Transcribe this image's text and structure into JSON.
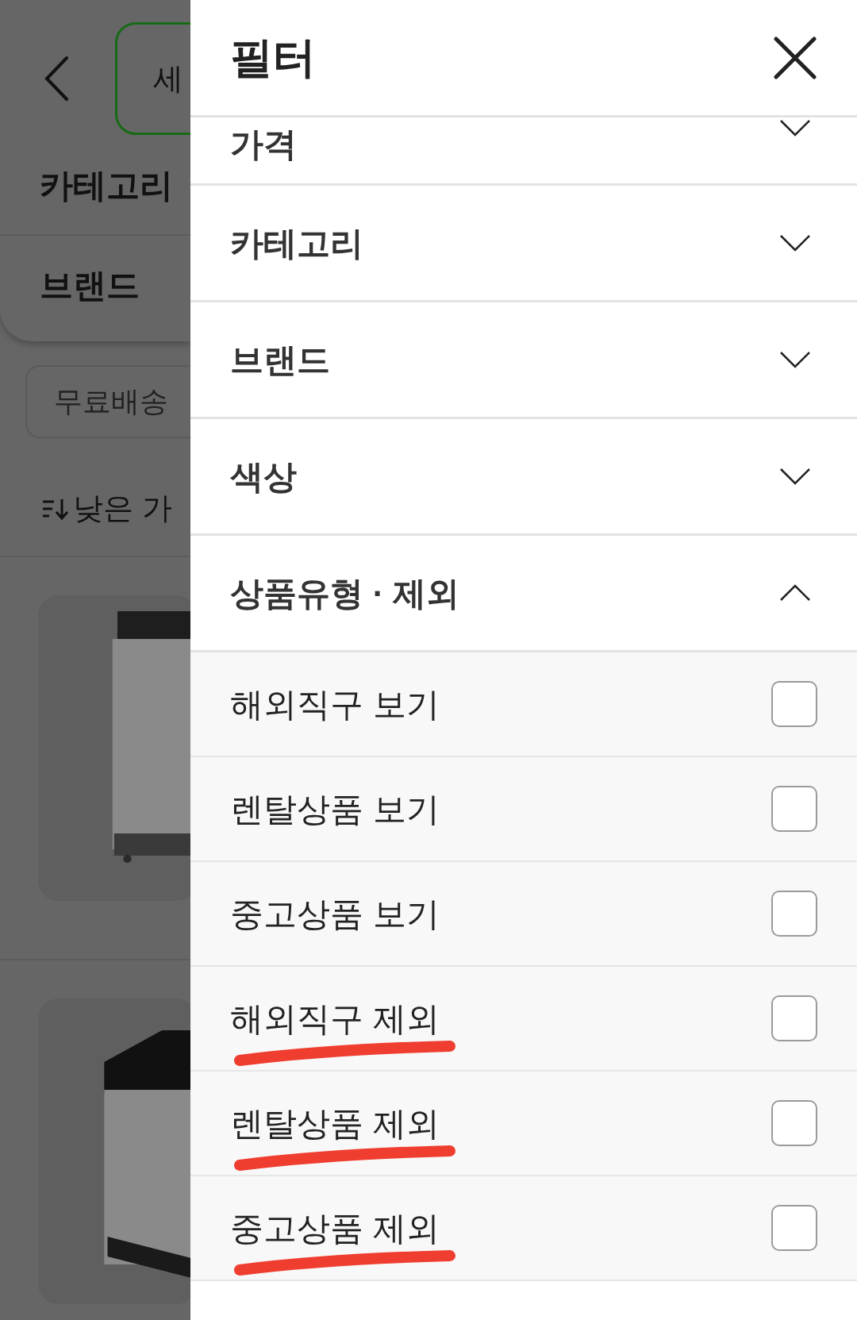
{
  "background": {
    "search_text": "세",
    "tabs": [
      {
        "label": "카테고리"
      },
      {
        "label": "브랜드"
      }
    ],
    "chip": "무료배송",
    "sort": "낮은 가"
  },
  "filter": {
    "title": "필터",
    "sections": [
      {
        "label": "가격",
        "expanded": false
      },
      {
        "label": "카테고리",
        "expanded": false
      },
      {
        "label": "브랜드",
        "expanded": false
      },
      {
        "label": "색상",
        "expanded": false
      },
      {
        "label": "상품유형 · 제외",
        "expanded": true,
        "options": [
          {
            "label": "해외직구 보기",
            "checked": false,
            "underlined": false
          },
          {
            "label": "렌탈상품 보기",
            "checked": false,
            "underlined": false
          },
          {
            "label": "중고상품 보기",
            "checked": false,
            "underlined": false
          },
          {
            "label": "해외직구 제외",
            "checked": false,
            "underlined": true
          },
          {
            "label": "렌탈상품 제외",
            "checked": false,
            "underlined": true
          },
          {
            "label": "중고상품 제외",
            "checked": false,
            "underlined": true
          }
        ]
      }
    ]
  }
}
